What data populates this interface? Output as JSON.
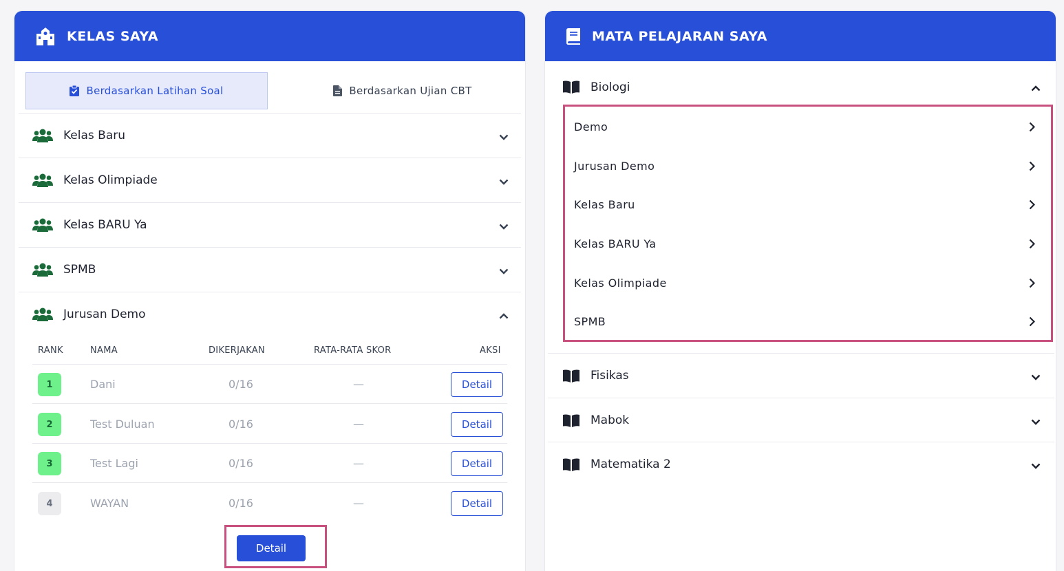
{
  "kelas": {
    "title": "KELAS SAYA",
    "tabs": [
      {
        "label": "Berdasarkan Latihan Soal",
        "active": true
      },
      {
        "label": "Berdasarkan Ujian CBT",
        "active": false
      }
    ],
    "classes": [
      {
        "label": "Kelas Baru",
        "expanded": false
      },
      {
        "label": "Kelas Olimpiade",
        "expanded": false
      },
      {
        "label": "Kelas BARU Ya",
        "expanded": false
      },
      {
        "label": "SPMB",
        "expanded": false
      },
      {
        "label": "Jurusan Demo",
        "expanded": true
      }
    ],
    "table": {
      "headers": [
        "RANK",
        "NAMA",
        "DIKERJAKAN",
        "RATA-RATA SKOR",
        "AKSI"
      ],
      "rows": [
        {
          "rank": "1",
          "name": "Dani",
          "done": "0/16",
          "avg": "—",
          "action": "Detail"
        },
        {
          "rank": "2",
          "name": "Test Duluan",
          "done": "0/16",
          "avg": "—",
          "action": "Detail"
        },
        {
          "rank": "3",
          "name": "Test Lagi",
          "done": "0/16",
          "avg": "—",
          "action": "Detail"
        },
        {
          "rank": "4",
          "name": "WAYAN",
          "done": "0/16",
          "avg": "—",
          "action": "Detail"
        }
      ]
    },
    "detail_button": "Detail"
  },
  "mapel": {
    "title": "MATA PELAJARAN SAYA",
    "subjects": [
      {
        "label": "Biologi",
        "expanded": true
      },
      {
        "label": "Fisikas",
        "expanded": false
      },
      {
        "label": "Mabok",
        "expanded": false
      },
      {
        "label": "Matematika 2",
        "expanded": false
      }
    ],
    "biologi_items": [
      "Demo",
      "Jurusan Demo",
      "Kelas Baru",
      "Kelas BARU Ya",
      "Kelas Olimpiade",
      "SPMB"
    ]
  },
  "colors": {
    "primary": "#284fd8",
    "highlight": "#c7507e",
    "group_icon": "#1b6b3a",
    "rank_green": "#6ef08b"
  }
}
